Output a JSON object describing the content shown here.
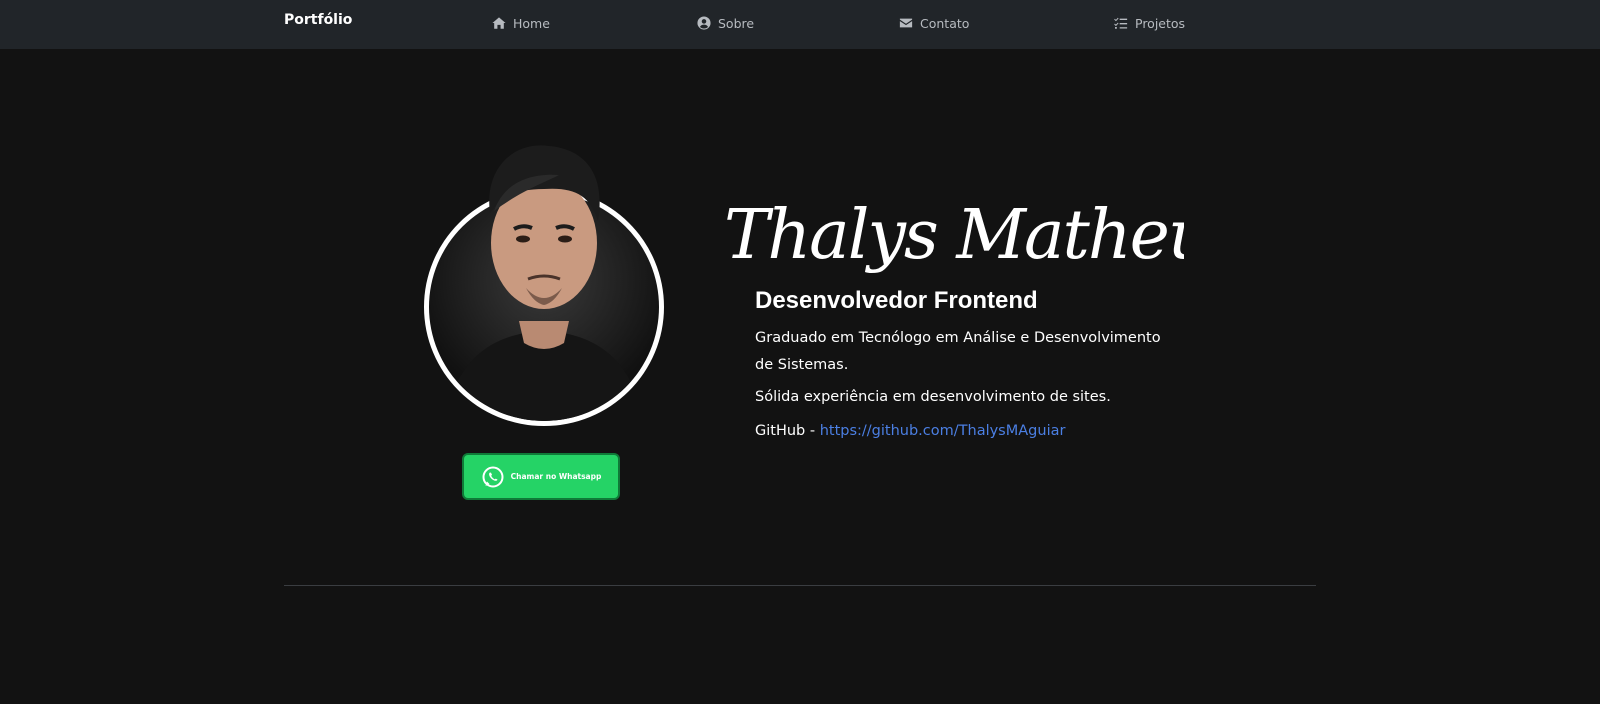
{
  "navbar": {
    "brand": "Portfólio",
    "links": [
      {
        "label": "Home",
        "icon": "home-icon"
      },
      {
        "label": "Sobre",
        "icon": "user-circle-icon"
      },
      {
        "label": "Contato",
        "icon": "envelope-icon"
      },
      {
        "label": "Projetos",
        "icon": "list-check-icon"
      }
    ]
  },
  "profile": {
    "signature": "Thalys Matheus",
    "role": "Desenvolvedor Frontend",
    "bio": "Graduado em Tecnólogo em Análise e Desenvolvimento de Sistemas.",
    "experience": "Sólida experiência em desenvolvimento de sites.",
    "github_prefix": "GitHub - ",
    "github_url": "https://github.com/ThalysMAguiar"
  },
  "whatsapp": {
    "label": "Chamar no Whatsapp",
    "icon": "whatsapp-icon"
  },
  "colors": {
    "background": "#121212",
    "navbar": "#212529",
    "whatsapp": "#25d366",
    "link": "#4b7fe3"
  }
}
